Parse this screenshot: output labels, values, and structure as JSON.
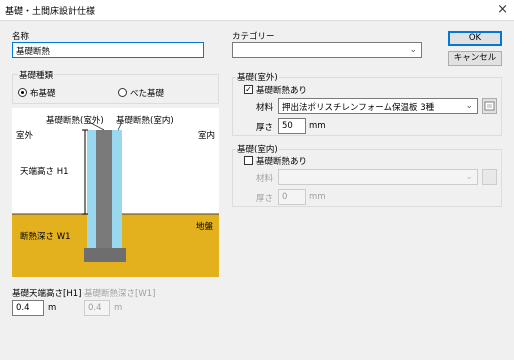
{
  "window": {
    "title": "基礎・土間床設計仕様",
    "close_icon": "×"
  },
  "name": {
    "label": "名称",
    "value": "基礎断熱"
  },
  "category": {
    "label": "カテゴリー",
    "value": ""
  },
  "buttons": {
    "ok": "OK",
    "cancel": "キャンセル"
  },
  "foundation_type": {
    "label": "基礎種類",
    "options": [
      {
        "label": "布基礎",
        "selected": true
      },
      {
        "label": "べた基礎",
        "selected": false
      }
    ]
  },
  "diagram": {
    "label_insulation_outdoor": "基礎断熱(室外)",
    "label_insulation_indoor": "基礎断熱(室内)",
    "label_outdoor": "室外",
    "label_indoor": "室内",
    "label_height": "天端高さ H1",
    "label_depth": "断熱深さ W1",
    "label_ground": "地盤",
    "colors": {
      "ground": "#e3b01e",
      "insulation": "#99d8ee",
      "concrete": "#7a7a7a"
    }
  },
  "outdoor": {
    "section_label": "基礎(室外)",
    "checkbox_label": "基礎断熱あり",
    "checked": true,
    "material_label": "材料",
    "material_value": "押出法ポリスチレンフォーム保温板 3種",
    "thickness_label": "厚さ",
    "thickness_value": "50",
    "unit": "mm"
  },
  "indoor": {
    "section_label": "基礎(室内)",
    "checkbox_label": "基礎断熱あり",
    "checked": false,
    "material_label": "材料",
    "material_value": "",
    "thickness_label": "厚さ",
    "thickness_value": "0",
    "unit": "mm"
  },
  "bottom": {
    "height_label": "基礎天端高さ[H1]",
    "height_value": "0.4",
    "height_unit": "m",
    "depth_label": "基礎断熱深さ[W1]",
    "depth_value": "0.4",
    "depth_unit": "m"
  }
}
